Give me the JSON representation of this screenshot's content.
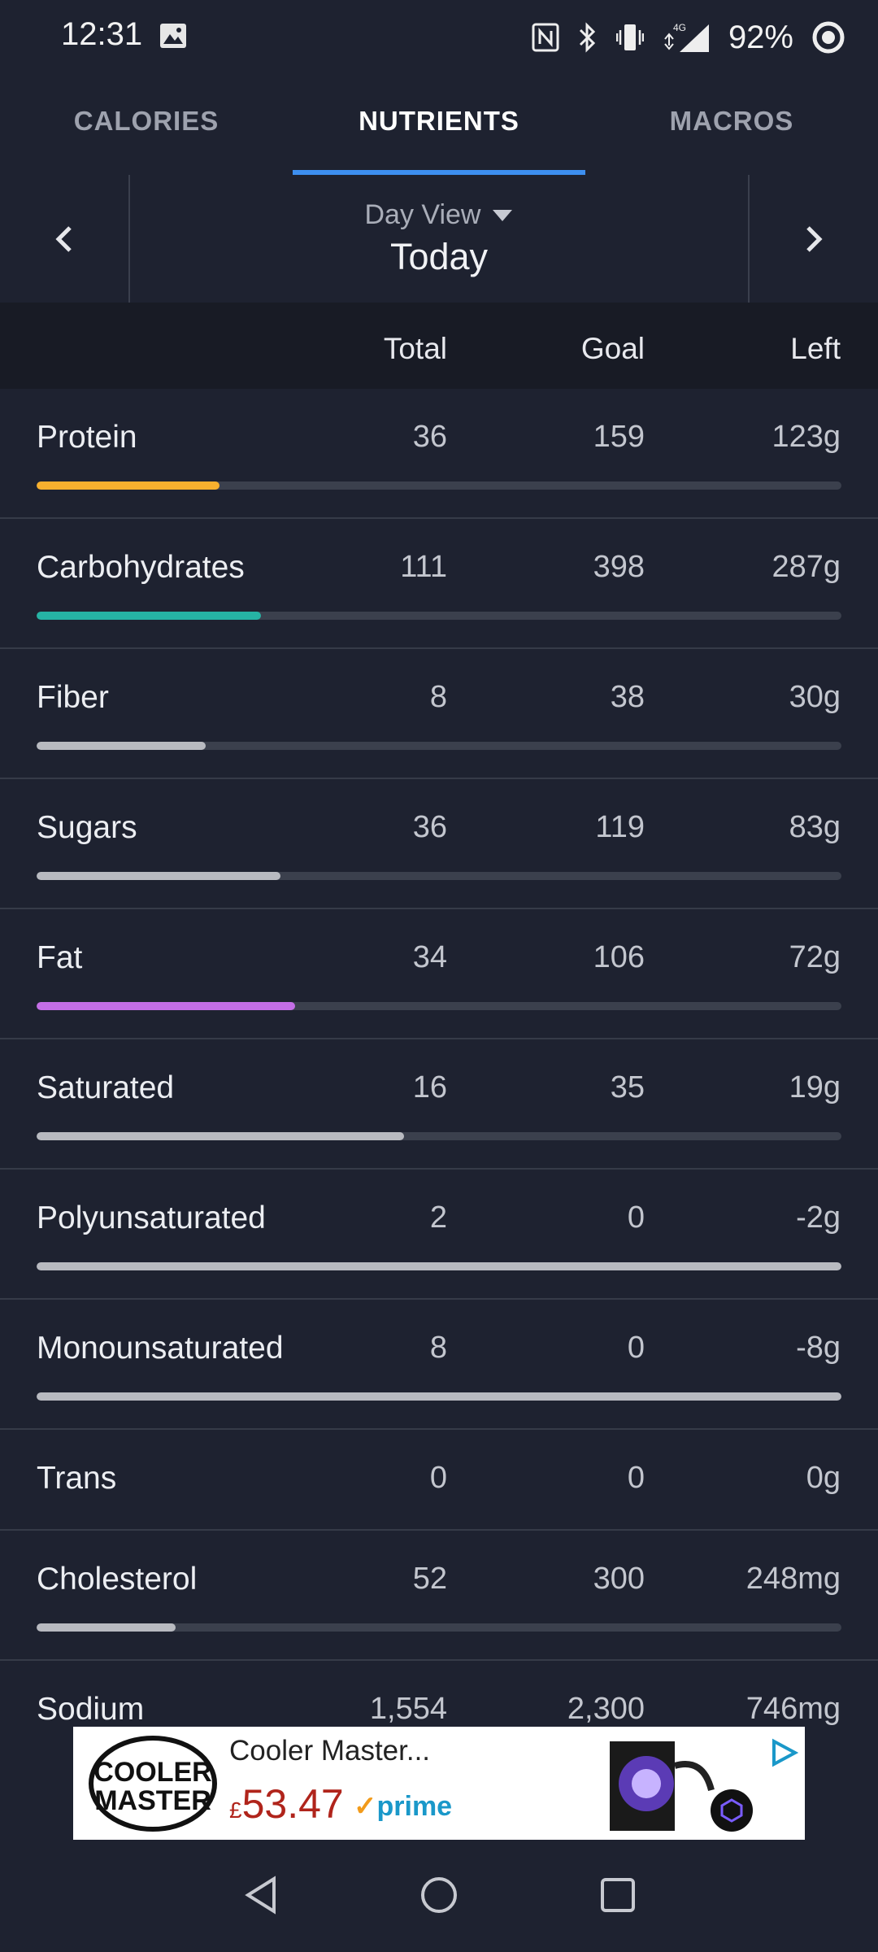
{
  "status_bar": {
    "time": "12:31",
    "battery": "92%",
    "network": "4G"
  },
  "tabs": [
    {
      "label": "CALORIES",
      "active": false
    },
    {
      "label": "NUTRIENTS",
      "active": true
    },
    {
      "label": "MACROS",
      "active": false
    }
  ],
  "date_nav": {
    "mode": "Day View",
    "day": "Today"
  },
  "columns": {
    "total": "Total",
    "goal": "Goal",
    "left": "Left"
  },
  "nutrients": [
    {
      "name": "Protein",
      "total": "36",
      "goal": "159",
      "left": "123g",
      "progress": 0.227,
      "color": "#f7b02e"
    },
    {
      "name": "Carbohydrates",
      "total": "111",
      "goal": "398",
      "left": "287g",
      "progress": 0.279,
      "color": "#26b3a4"
    },
    {
      "name": "Fiber",
      "total": "8",
      "goal": "38",
      "left": "30g",
      "progress": 0.21,
      "color": "#b8bac0"
    },
    {
      "name": "Sugars",
      "total": "36",
      "goal": "119",
      "left": "83g",
      "progress": 0.303,
      "color": "#b8bac0"
    },
    {
      "name": "Fat",
      "total": "34",
      "goal": "106",
      "left": "72g",
      "progress": 0.321,
      "color": "#c46ee6"
    },
    {
      "name": "Saturated",
      "total": "16",
      "goal": "35",
      "left": "19g",
      "progress": 0.457,
      "color": "#b8bac0"
    },
    {
      "name": "Polyunsaturated",
      "total": "2",
      "goal": "0",
      "left": "-2g",
      "progress": 1.0,
      "color": "#b8bac0"
    },
    {
      "name": "Monounsaturated",
      "total": "8",
      "goal": "0",
      "left": "-8g",
      "progress": 1.0,
      "color": "#b8bac0"
    },
    {
      "name": "Trans",
      "total": "0",
      "goal": "0",
      "left": "0g",
      "progress": null,
      "color": "#b8bac0"
    },
    {
      "name": "Cholesterol",
      "total": "52",
      "goal": "300",
      "left": "248mg",
      "progress": 0.173,
      "color": "#b8bac0"
    },
    {
      "name": "Sodium",
      "total": "1,554",
      "goal": "2,300",
      "left": "746mg",
      "progress": null,
      "color": "#b8bac0"
    }
  ],
  "ad": {
    "brand_line1": "COOLER",
    "brand_line2": "MASTER",
    "title": "Cooler Master...",
    "currency": "£",
    "price": "53.47",
    "prime": "prime"
  },
  "icons": {
    "prev": "chevron-left-icon",
    "next": "chevron-right-icon",
    "dropdown": "caret-down-icon",
    "back": "nav-back-icon",
    "home": "nav-home-icon",
    "recents": "nav-recents-icon"
  }
}
